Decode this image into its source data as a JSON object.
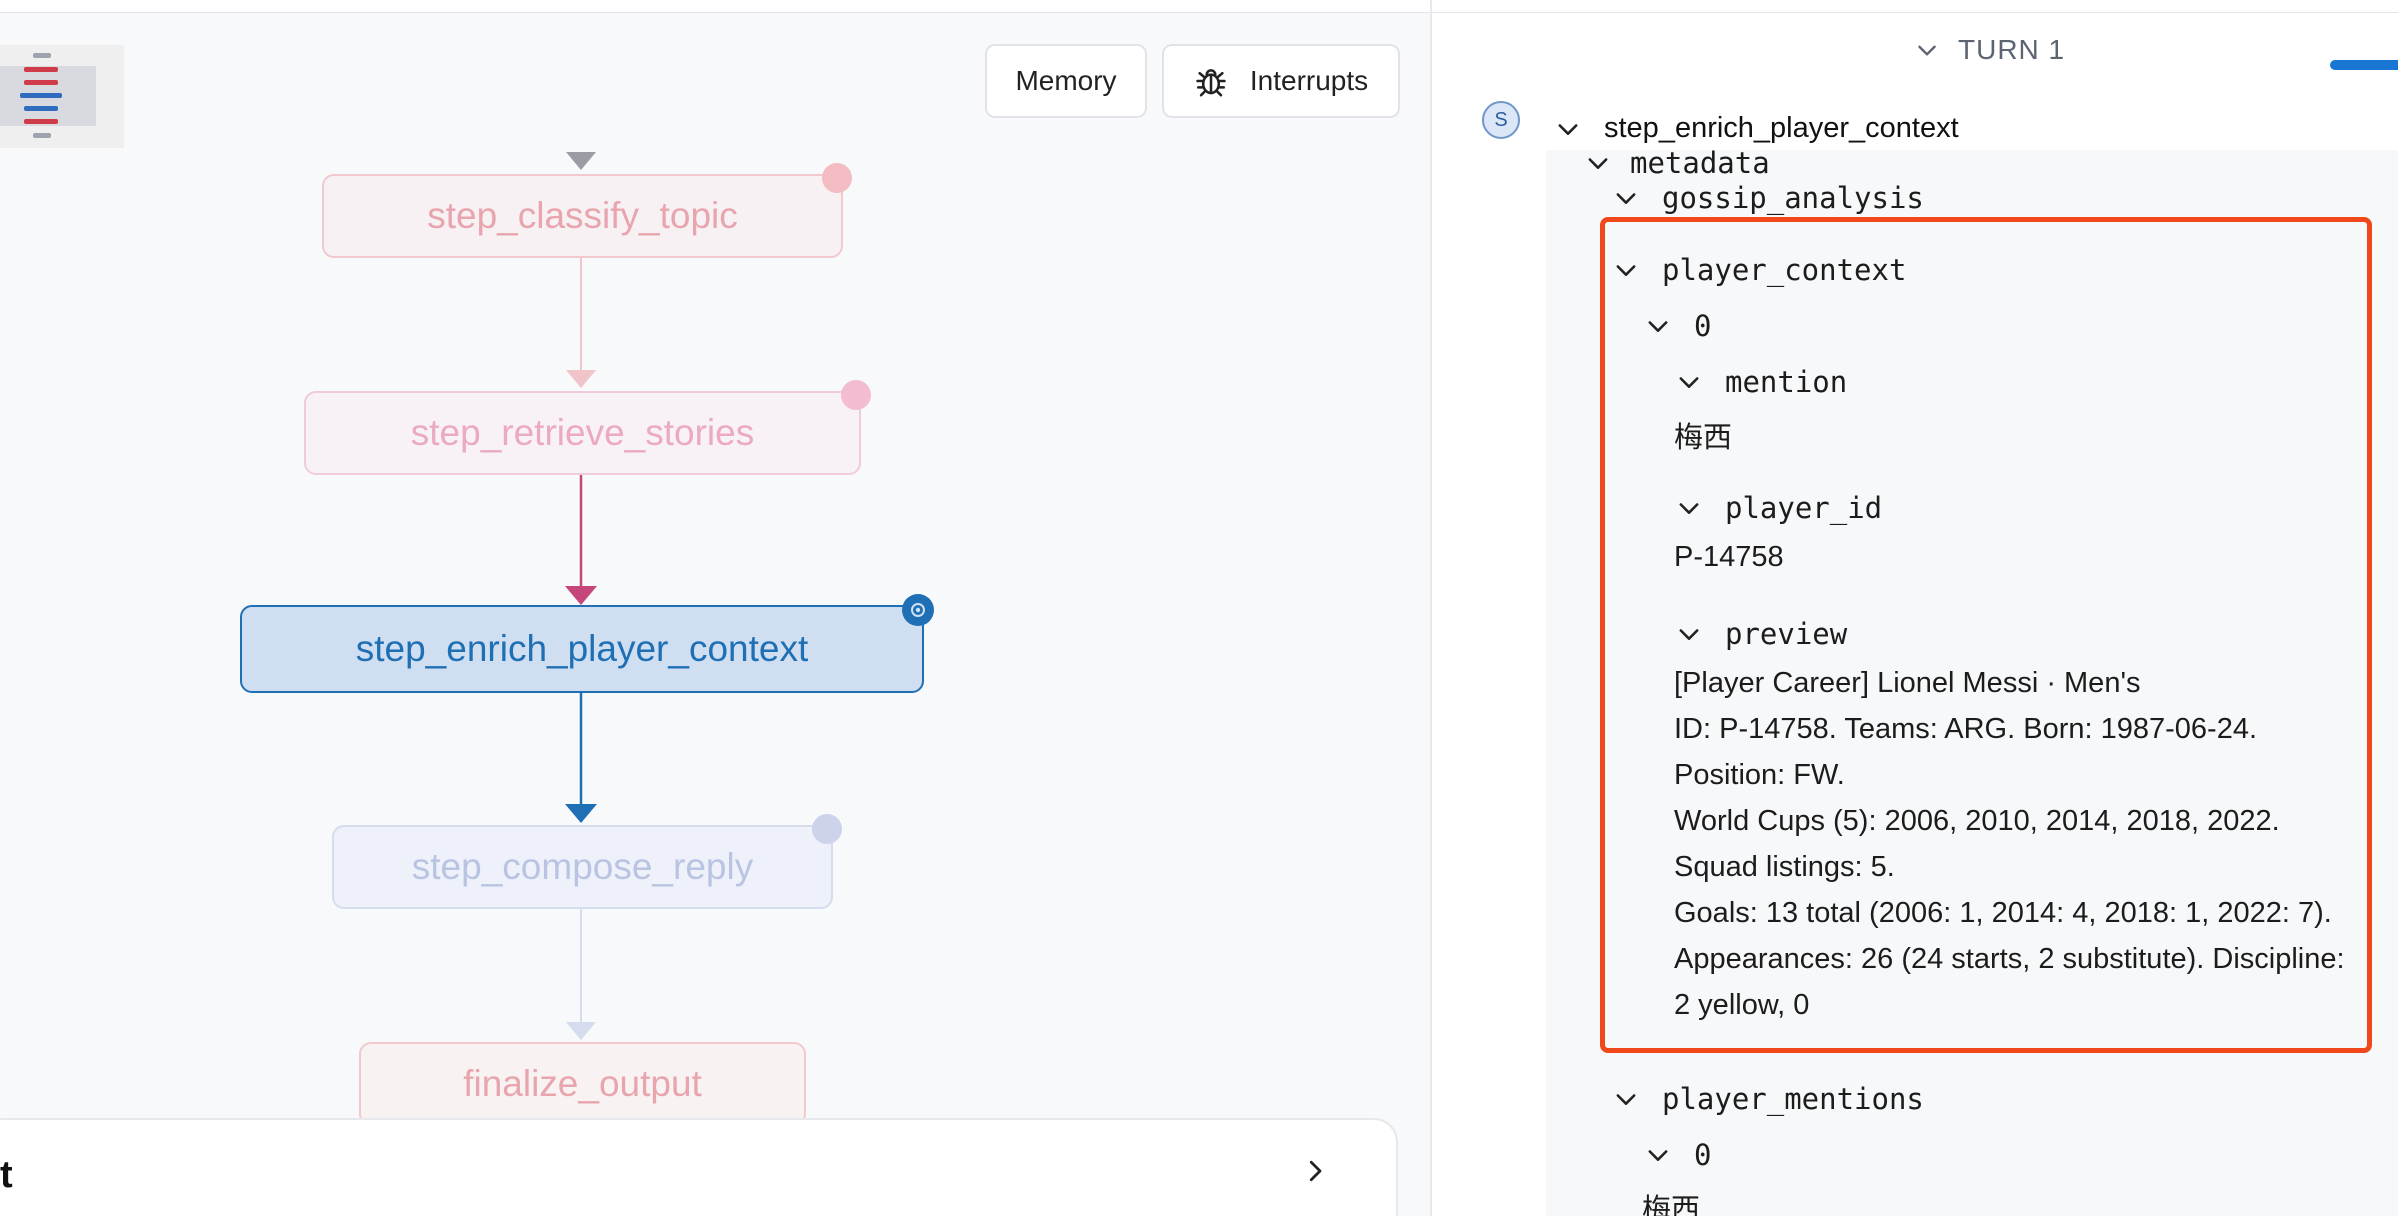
{
  "toolbar": {
    "memory_label": "Memory",
    "interrupts_label": "Interrupts",
    "interrupts_icon": "bug-icon"
  },
  "legend": {
    "icon": "layers-legend-icon"
  },
  "graph": {
    "nodes": [
      {
        "id": "step_classify_topic",
        "label": "step_classify_topic",
        "state": "faded",
        "color": "#e8a5ad"
      },
      {
        "id": "step_retrieve_stories",
        "label": "step_retrieve_stories",
        "state": "faded",
        "color": "#eba9c4"
      },
      {
        "id": "step_enrich_player_context",
        "label": "step_enrich_player_context",
        "state": "active",
        "color": "#1f6fb4"
      },
      {
        "id": "step_compose_reply",
        "label": "step_compose_reply",
        "state": "faded",
        "color": "#b9c4e2"
      },
      {
        "id": "finalize_output",
        "label": "finalize_output",
        "state": "faded",
        "color": "#e8a5ad"
      }
    ],
    "colors": {
      "active_fill": "#cfdff1",
      "active_edge": "#1f6fb4",
      "highlight_edge": "#c6457a"
    }
  },
  "bottom_card": {
    "title": "t",
    "chevron_icon": "chevron-right-icon"
  },
  "inspector": {
    "turn_label": "TURN 1",
    "step_badge": "S",
    "step_name": "step_enrich_player_context",
    "tree": {
      "metadata": "metadata",
      "gossip_analysis": "gossip_analysis",
      "player_context": "player_context",
      "index0": "0",
      "mention_key": "mention",
      "mention_value": "梅西",
      "player_id_key": "player_id",
      "player_id_value": "P-14758",
      "preview_key": "preview",
      "preview_lines": [
        "[Player Career] Lionel Messi · Men's",
        "ID: P-14758. Teams: ARG. Born: 1987-06-24.",
        "Position: FW.",
        "World Cups (5): 2006, 2010, 2014, 2018, 2022.",
        "Squad listings: 5.",
        "Goals: 13 total (2006: 1, 2014: 4, 2018: 1, 2022: 7).",
        "Appearances: 26 (24 starts, 2 substitute). Discipline:",
        "2 yellow, 0"
      ],
      "player_mentions": "player_mentions",
      "mentions_index0": "0",
      "mentions_value": "梅西"
    },
    "highlight_color": "#f0481a"
  }
}
